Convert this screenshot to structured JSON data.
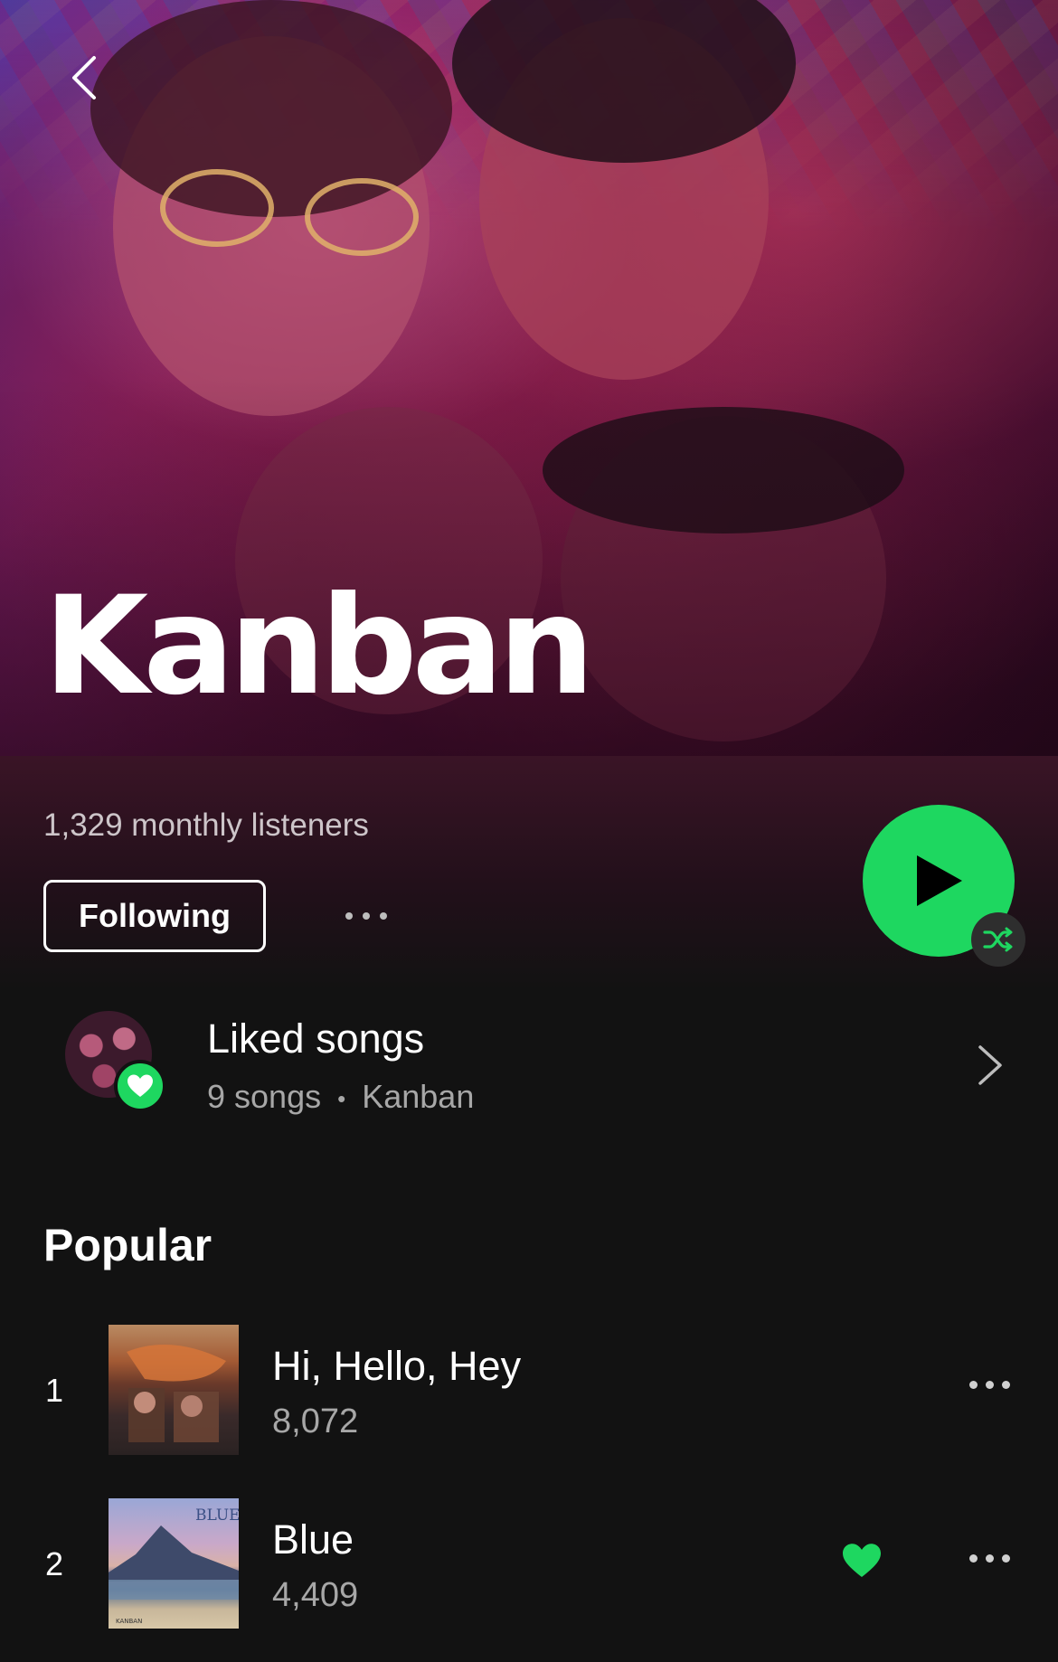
{
  "artist": {
    "name": "Kanban",
    "monthly_listeners": "1,329 monthly listeners",
    "follow_label": "Following"
  },
  "icons": {
    "back": "chevron-left-icon",
    "more": "more-horizontal-icon",
    "play": "play-icon",
    "shuffle": "shuffle-icon",
    "heart": "heart-icon",
    "chevron": "chevron-right-icon"
  },
  "colors": {
    "accent": "#1ed760",
    "background": "#121212",
    "muted_text": "#a7a7a7"
  },
  "liked_songs": {
    "title": "Liked songs",
    "count": "9 songs",
    "separator": "•",
    "artist": "Kanban"
  },
  "popular": {
    "title": "Popular",
    "tracks": [
      {
        "rank": "1",
        "title": "Hi, Hello, Hey",
        "plays": "8,072",
        "liked": false
      },
      {
        "rank": "2",
        "title": "Blue",
        "plays": "4,409",
        "liked": true
      }
    ]
  },
  "album_art": {
    "blue_text": "BLUE",
    "blue_footer": "KANBAN"
  }
}
